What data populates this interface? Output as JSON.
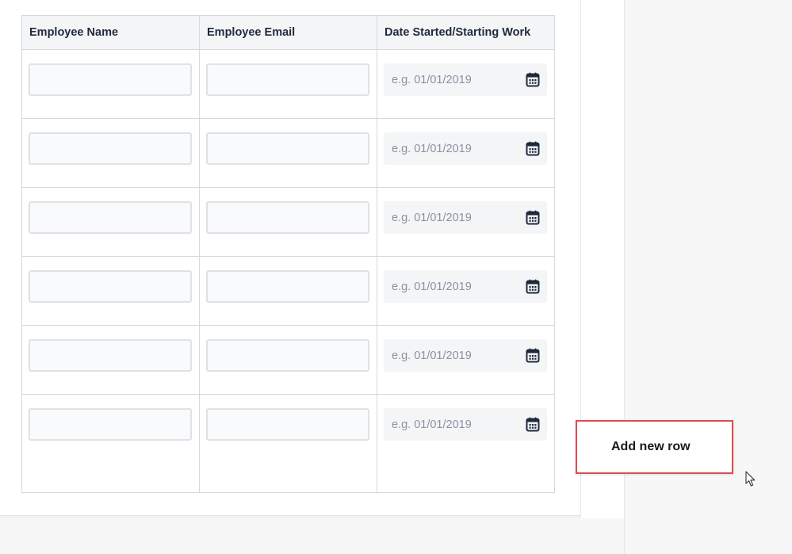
{
  "table": {
    "headers": [
      "Employee Name",
      "Employee Email",
      "Date Started/Starting Work"
    ],
    "date_placeholder": "e.g. 01/01/2019",
    "rows": [
      {
        "name": "",
        "email": "",
        "date": ""
      },
      {
        "name": "",
        "email": "",
        "date": ""
      },
      {
        "name": "",
        "email": "",
        "date": ""
      },
      {
        "name": "",
        "email": "",
        "date": ""
      },
      {
        "name": "",
        "email": "",
        "date": ""
      },
      {
        "name": "",
        "email": "",
        "date": ""
      }
    ]
  },
  "add_row_label": "Add new row",
  "icons": {
    "date_picker": "calendar-icon",
    "pointer": "mouse-cursor-icon"
  },
  "colors": {
    "highlight_border": "#e04a4f",
    "header_text": "#1f2a3d",
    "calendar_icon": "#1f2a3d"
  }
}
